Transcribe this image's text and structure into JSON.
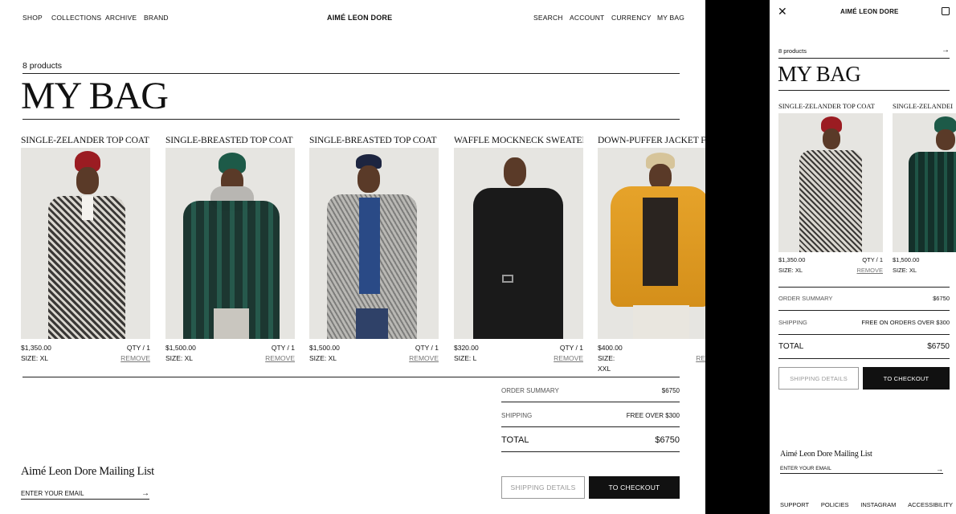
{
  "brand": "AIMÉ LEON DORE",
  "nav_left": [
    "SHOP",
    "COLLECTIONS",
    "ARCHIVE",
    "BRAND"
  ],
  "nav_right": [
    "SEARCH",
    "ACCOUNT",
    "CURRENCY",
    "MY BAG"
  ],
  "product_count": "8 products",
  "page_title": "MY BAG",
  "products": [
    {
      "name": "SINGLE-ZELANDER TOP COAT",
      "price": "$1,350.00",
      "qty": "QTY / 1",
      "size": "SIZE: XL",
      "remove": "REMOVE"
    },
    {
      "name": "SINGLE-BREASTED TOP COAT",
      "price": "$1,500.00",
      "qty": "QTY / 1",
      "size": "SIZE: XL",
      "remove": "REMOVE"
    },
    {
      "name": "SINGLE-BREASTED TOP COAT",
      "price": "$1,500.00",
      "qty": "QTY / 1",
      "size": "SIZE: XL",
      "remove": "REMOVE"
    },
    {
      "name": "WAFFLE MOCKNECK SWEATER",
      "price": "$320.00",
      "qty": "QTY / 1",
      "size": "SIZE: L",
      "remove": "REMOVE"
    },
    {
      "name": "DOWN-PUFFER JACKET F",
      "price": "$400.00",
      "qty": "",
      "size": "SIZE: XXL",
      "remove": "RE"
    }
  ],
  "summary": {
    "order_label": "ORDER SUMMARY",
    "order_value": "$6750",
    "shipping_label": "SHIPPING",
    "shipping_value": "FREE OVER $300",
    "total_label": "TOTAL",
    "total_value": "$6750"
  },
  "buttons": {
    "shipping": "SHIPPING DETAILS",
    "checkout": "TO CHECKOUT"
  },
  "mailing": {
    "title": "Aimé Leon Dore Mailing List",
    "placeholder": "ENTER YOUR EMAIL"
  },
  "mobile": {
    "brand": "AIMÉ LEON DORE",
    "product_count": "8 products",
    "title": "MY BAG",
    "products": [
      {
        "name": "SINGLE-ZELANDER TOP COAT",
        "price": "$1,350.00",
        "qty": "QTY / 1",
        "size": "SIZE: XL",
        "remove": "REMOVE"
      },
      {
        "name": "SINGLE-ZELANDEI",
        "price": "$1,500.00",
        "size": "SIZE: XL"
      }
    ],
    "order_label": "ORDER SUMMARY",
    "order_value": "$6750",
    "shipping_label": "SHIPPING",
    "shipping_value": "FREE ON ORDERS OVER $300",
    "total_label": "TOTAL",
    "total_value": "$6750",
    "shipping_btn": "SHIPPING DETAILS",
    "checkout_btn": "TO CHECKOUT",
    "mailing_title": "Aimé Leon Dore Mailing List",
    "mailing_placeholder": "ENTER YOUR EMAIL",
    "footer": [
      "SUPPORT",
      "POLICIES",
      "INSTAGRAM",
      "ACCESSIBILITY"
    ]
  },
  "colors": {
    "black_panel": "#000000",
    "button_dark": "#111111",
    "image_bg": "#e6e5e1"
  },
  "icons": [
    "arrow-right-icon",
    "close-icon",
    "bag-icon"
  ]
}
